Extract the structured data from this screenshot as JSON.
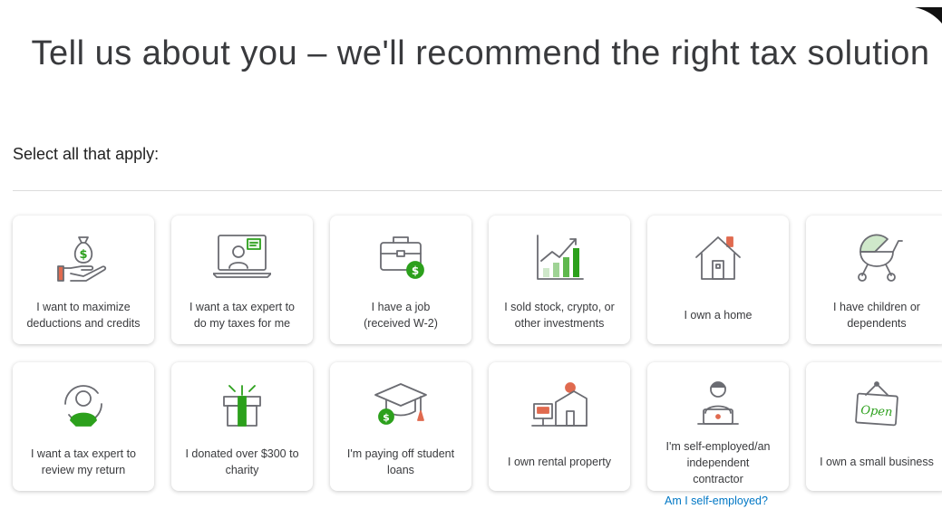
{
  "page": {
    "title": "Tell us about you – we'll recommend the right tax solution",
    "prompt": "Select all that apply:"
  },
  "options": {
    "row1": [
      {
        "label": "I want to maximize\ndeductions and credits",
        "icon": "money-bag-hand-icon"
      },
      {
        "label": "I want a tax expert to\ndo my taxes for me",
        "icon": "laptop-expert-icon"
      },
      {
        "label": "I have a job\n(received W-2)",
        "icon": "briefcase-dollar-icon"
      },
      {
        "label": "I sold stock, crypto, or\nother investments",
        "icon": "investment-chart-icon"
      },
      {
        "label": "I own a home",
        "icon": "house-icon"
      },
      {
        "label": "I have children or\ndependents",
        "icon": "stroller-icon"
      }
    ],
    "row2": [
      {
        "label": "I want a tax expert to\nreview my return",
        "icon": "expert-review-icon"
      },
      {
        "label": "I donated over $300 to\ncharity",
        "icon": "gift-icon"
      },
      {
        "label": "I'm paying off student\nloans",
        "icon": "graduation-cap-icon"
      },
      {
        "label": "I own rental property",
        "icon": "rental-property-icon"
      },
      {
        "label": "I'm self-employed/an\nindependent\ncontractor",
        "icon": "self-employed-icon"
      },
      {
        "label": "I own a small business",
        "icon": "open-sign-icon"
      }
    ]
  },
  "self_employed_help": "Am I self-employed?",
  "colors": {
    "accent_green": "#2ca01c",
    "link_blue": "#0077c5",
    "icon_gray": "#6b6c72",
    "accent_red": "#e06a4f"
  }
}
